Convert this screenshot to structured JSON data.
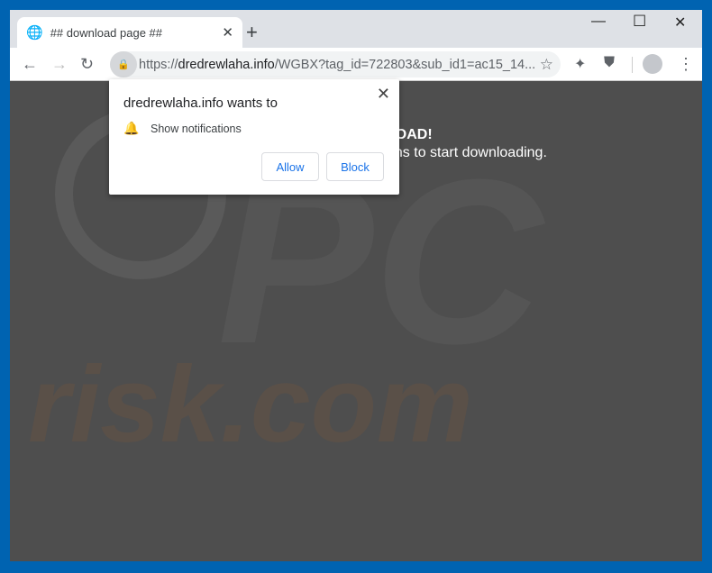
{
  "tab": {
    "title": "## download page ##",
    "icon": "globe-icon"
  },
  "address": {
    "scheme": "https://",
    "domain": "dredrewlaha.info",
    "path": "/WGBX?tag_id=722803&sub_id1=ac15_14..."
  },
  "page": {
    "heading_partial": "LOAD!",
    "subtext_partial": "ons to start downloading.",
    "watermark": "PC risk.com"
  },
  "popup": {
    "title": "dredrewlaha.info wants to",
    "permission": "Show notifications",
    "allow": "Allow",
    "block": "Block"
  },
  "colors": {
    "desktop": "#0063b1",
    "accent": "#1a73e8",
    "page_bg": "#4e4e4e"
  }
}
